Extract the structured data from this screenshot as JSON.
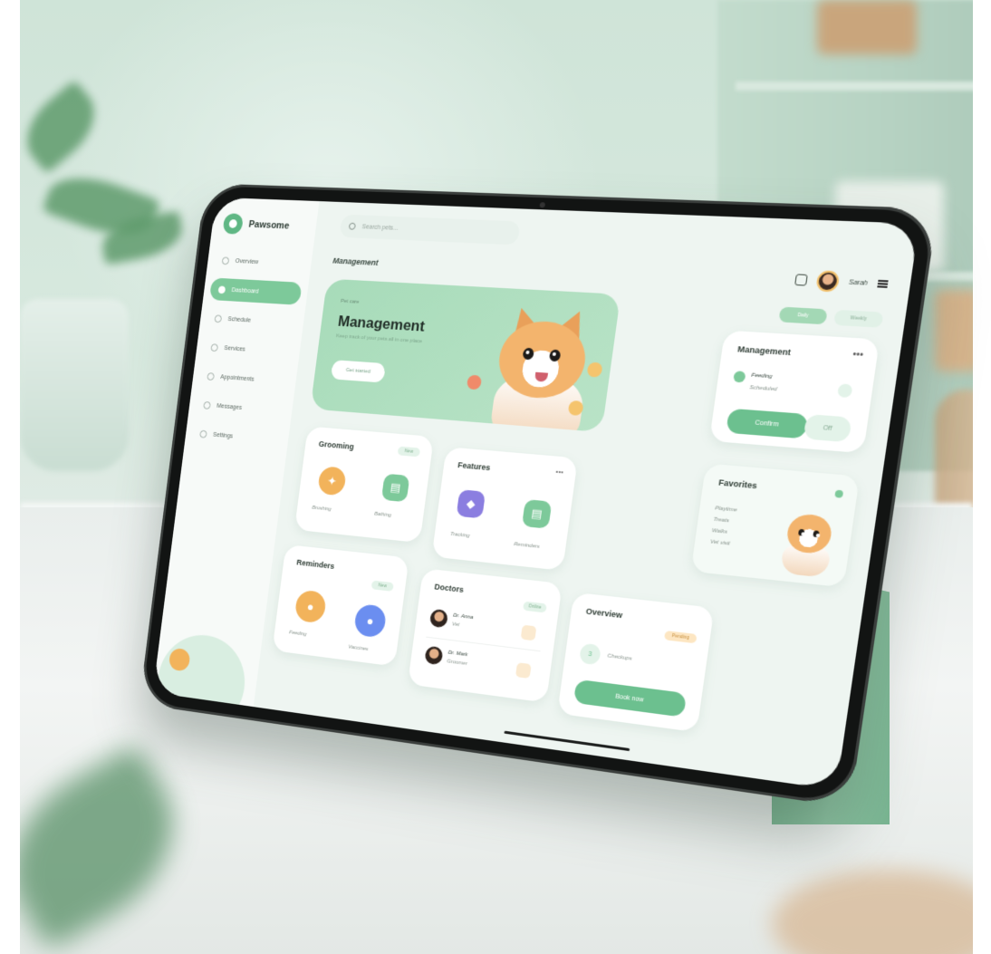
{
  "app": {
    "brand": "Pawsome"
  },
  "search": {
    "placeholder": "Search pets..."
  },
  "sidebar": {
    "items": [
      {
        "label": "Overview"
      },
      {
        "label": "Dashboard"
      },
      {
        "label": "Schedule"
      },
      {
        "label": "Services"
      },
      {
        "label": "Appointments"
      },
      {
        "label": "Messages"
      },
      {
        "label": "Settings"
      }
    ]
  },
  "header": {
    "title": "Management",
    "user_name": "Sarah"
  },
  "hero": {
    "eyebrow": "Pet care",
    "title": "Management",
    "subtitle": "Keep track of your pets all in one place",
    "button": "Get started"
  },
  "filters": [
    "Daily",
    "Weekly"
  ],
  "cards": {
    "management": {
      "title": "Management",
      "item": "Feeding",
      "item_sub": "Scheduled",
      "button": "Confirm",
      "toggle": "Off"
    },
    "grooming": {
      "title": "Grooming",
      "tag": "New",
      "captions": [
        "Brushing",
        "Bathing"
      ]
    },
    "features": {
      "title": "Features",
      "captions": [
        "Tracking",
        "Reminders"
      ]
    },
    "favorites": {
      "title": "Favorites",
      "lines": [
        "Playtime",
        "Treats",
        "Walks",
        "Vet visit"
      ]
    },
    "reminders": {
      "title": "Reminders",
      "tag": "New",
      "captions": [
        "Feeding",
        "Vaccines"
      ]
    },
    "doctors": {
      "title": "Doctors",
      "tag": "Online",
      "rows": [
        {
          "name": "Dr. Anna",
          "sub": "Vet"
        },
        {
          "name": "Dr. Mark",
          "sub": "Groomer"
        }
      ]
    },
    "overview": {
      "title": "Overview",
      "tag": "Pending",
      "step": "3",
      "step_label": "Checkups",
      "button": "Book now"
    }
  },
  "colors": {
    "accent": "#6cc08f",
    "hero": "#a7dbb9",
    "orange": "#f2b35b",
    "purple": "#8b7ee0",
    "blue": "#6b8ef0"
  }
}
